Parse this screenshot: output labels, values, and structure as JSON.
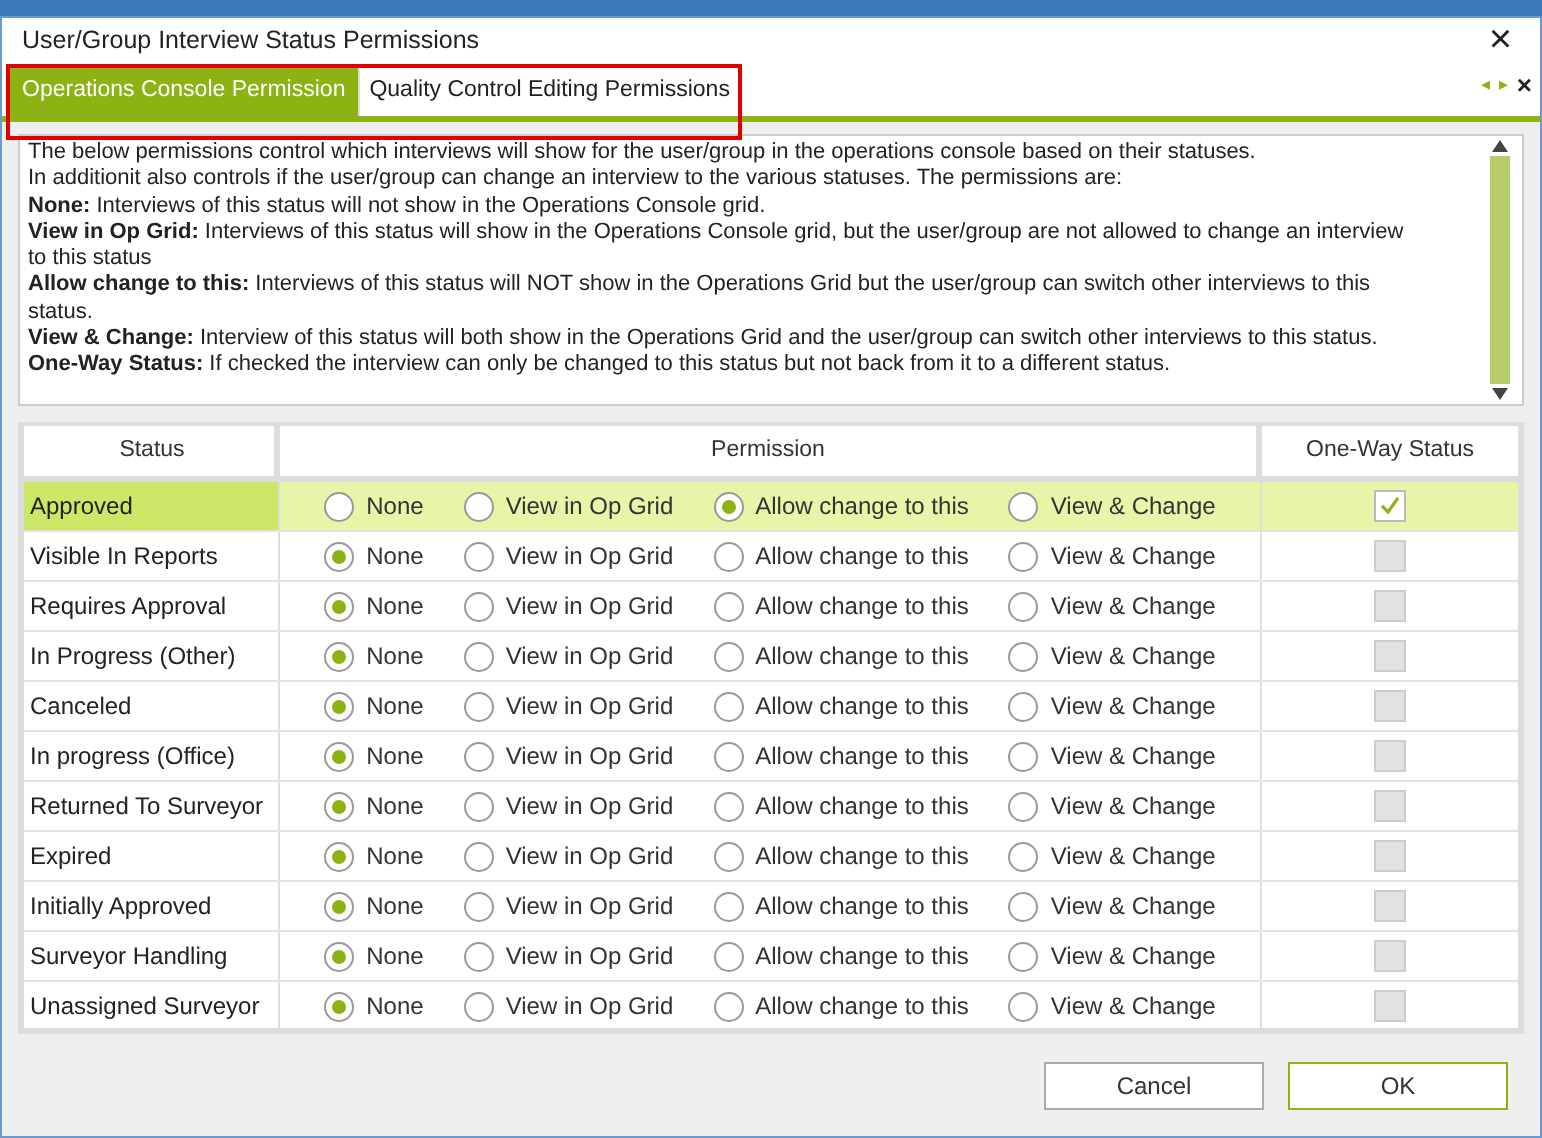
{
  "window": {
    "title": "User/Group Interview Status Permissions",
    "close": "×"
  },
  "tabs": [
    {
      "label": "Operations Console Permission",
      "selected": true
    },
    {
      "label": "Quality Control Editing Permissions",
      "selected": false
    }
  ],
  "tab_nav": {
    "prev": "◂",
    "next": "▸",
    "close": "×"
  },
  "description": [
    "The below permissions control which interviews will show for the user/group in the operations console based on their statuses.",
    "In additionit also controls if the user/group can change an interview to the various statuses. The permissions are:",
    "**None:** Interviews of this status will not show in the Operations Console grid.",
    "**View in Op Grid:** Interviews of this status will show in the Operations Console grid, but the user/group are not allowed to change an interview to this status",
    "**Allow change to this:** Interviews of this status will NOT show in the Operations Grid but the user/group can switch other interviews to this status.",
    "**View & Change:** Interview of this status will both show in the Operations Grid and the user/group can switch other interviews to this status.",
    "**One-Way Status:** If checked the interview can only be changed to this status but not back from it to a different status."
  ],
  "table": {
    "columns": [
      "Status",
      "Permission",
      "One-Way Status"
    ],
    "rows": [
      {
        "status": "Approved",
        "selected": true,
        "options": [
          {
            "label": "None",
            "selected": false
          },
          {
            "label": "View in Op Grid",
            "selected": false
          },
          {
            "label": "Allow change to this",
            "selected": true
          },
          {
            "label": "View & Change",
            "selected": false
          }
        ],
        "one_way_checked": true,
        "one_way_disabled": false
      },
      {
        "status": "Visible In Reports",
        "selected": false,
        "options": [
          {
            "label": "None",
            "selected": true
          },
          {
            "label": "View in Op Grid",
            "selected": false
          },
          {
            "label": "Allow change to this",
            "selected": false
          },
          {
            "label": "View & Change",
            "selected": false
          }
        ],
        "one_way_checked": false,
        "one_way_disabled": true
      },
      {
        "status": "Requires Approval",
        "selected": false,
        "options": [
          {
            "label": "None",
            "selected": true
          },
          {
            "label": "View in Op Grid",
            "selected": false
          },
          {
            "label": "Allow change to this",
            "selected": false
          },
          {
            "label": "View & Change",
            "selected": false
          }
        ],
        "one_way_checked": false,
        "one_way_disabled": true
      },
      {
        "status": "In Progress (Other)",
        "selected": false,
        "options": [
          {
            "label": "None",
            "selected": true
          },
          {
            "label": "View in Op Grid",
            "selected": false
          },
          {
            "label": "Allow change to this",
            "selected": false
          },
          {
            "label": "View & Change",
            "selected": false
          }
        ],
        "one_way_checked": false,
        "one_way_disabled": true
      },
      {
        "status": "Canceled",
        "selected": false,
        "options": [
          {
            "label": "None",
            "selected": true
          },
          {
            "label": "View in Op Grid",
            "selected": false
          },
          {
            "label": "Allow change to this",
            "selected": false
          },
          {
            "label": "View & Change",
            "selected": false
          }
        ],
        "one_way_checked": false,
        "one_way_disabled": true
      },
      {
        "status": "In progress (Office)",
        "selected": false,
        "options": [
          {
            "label": "None",
            "selected": true
          },
          {
            "label": "View in Op Grid",
            "selected": false
          },
          {
            "label": "Allow change to this",
            "selected": false
          },
          {
            "label": "View & Change",
            "selected": false
          }
        ],
        "one_way_checked": false,
        "one_way_disabled": true
      },
      {
        "status": "Returned To Surveyor",
        "selected": false,
        "options": [
          {
            "label": "None",
            "selected": true
          },
          {
            "label": "View in Op Grid",
            "selected": false
          },
          {
            "label": "Allow change to this",
            "selected": false
          },
          {
            "label": "View & Change",
            "selected": false
          }
        ],
        "one_way_checked": false,
        "one_way_disabled": true
      },
      {
        "status": "Expired",
        "selected": false,
        "options": [
          {
            "label": "None",
            "selected": true
          },
          {
            "label": "View in Op Grid",
            "selected": false
          },
          {
            "label": "Allow change to this",
            "selected": false
          },
          {
            "label": "View & Change",
            "selected": false
          }
        ],
        "one_way_checked": false,
        "one_way_disabled": true
      },
      {
        "status": "Initially Approved",
        "selected": false,
        "options": [
          {
            "label": "None",
            "selected": true
          },
          {
            "label": "View in Op Grid",
            "selected": false
          },
          {
            "label": "Allow change to this",
            "selected": false
          },
          {
            "label": "View & Change",
            "selected": false
          }
        ],
        "one_way_checked": false,
        "one_way_disabled": true
      },
      {
        "status": "Surveyor Handling",
        "selected": false,
        "options": [
          {
            "label": "None",
            "selected": true
          },
          {
            "label": "View in Op Grid",
            "selected": false
          },
          {
            "label": "Allow change to this",
            "selected": false
          },
          {
            "label": "View & Change",
            "selected": false
          }
        ],
        "one_way_checked": false,
        "one_way_disabled": true
      },
      {
        "status": "Unassigned Surveyor",
        "selected": false,
        "options": [
          {
            "label": "None",
            "selected": true
          },
          {
            "label": "View in Op Grid",
            "selected": false
          },
          {
            "label": "Allow change to this",
            "selected": false
          },
          {
            "label": "View & Change",
            "selected": false
          }
        ],
        "one_way_checked": false,
        "one_way_disabled": true
      }
    ]
  },
  "buttons": [
    {
      "label": "Cancel",
      "kind": "secondary"
    },
    {
      "label": "OK",
      "kind": "primary"
    }
  ]
}
